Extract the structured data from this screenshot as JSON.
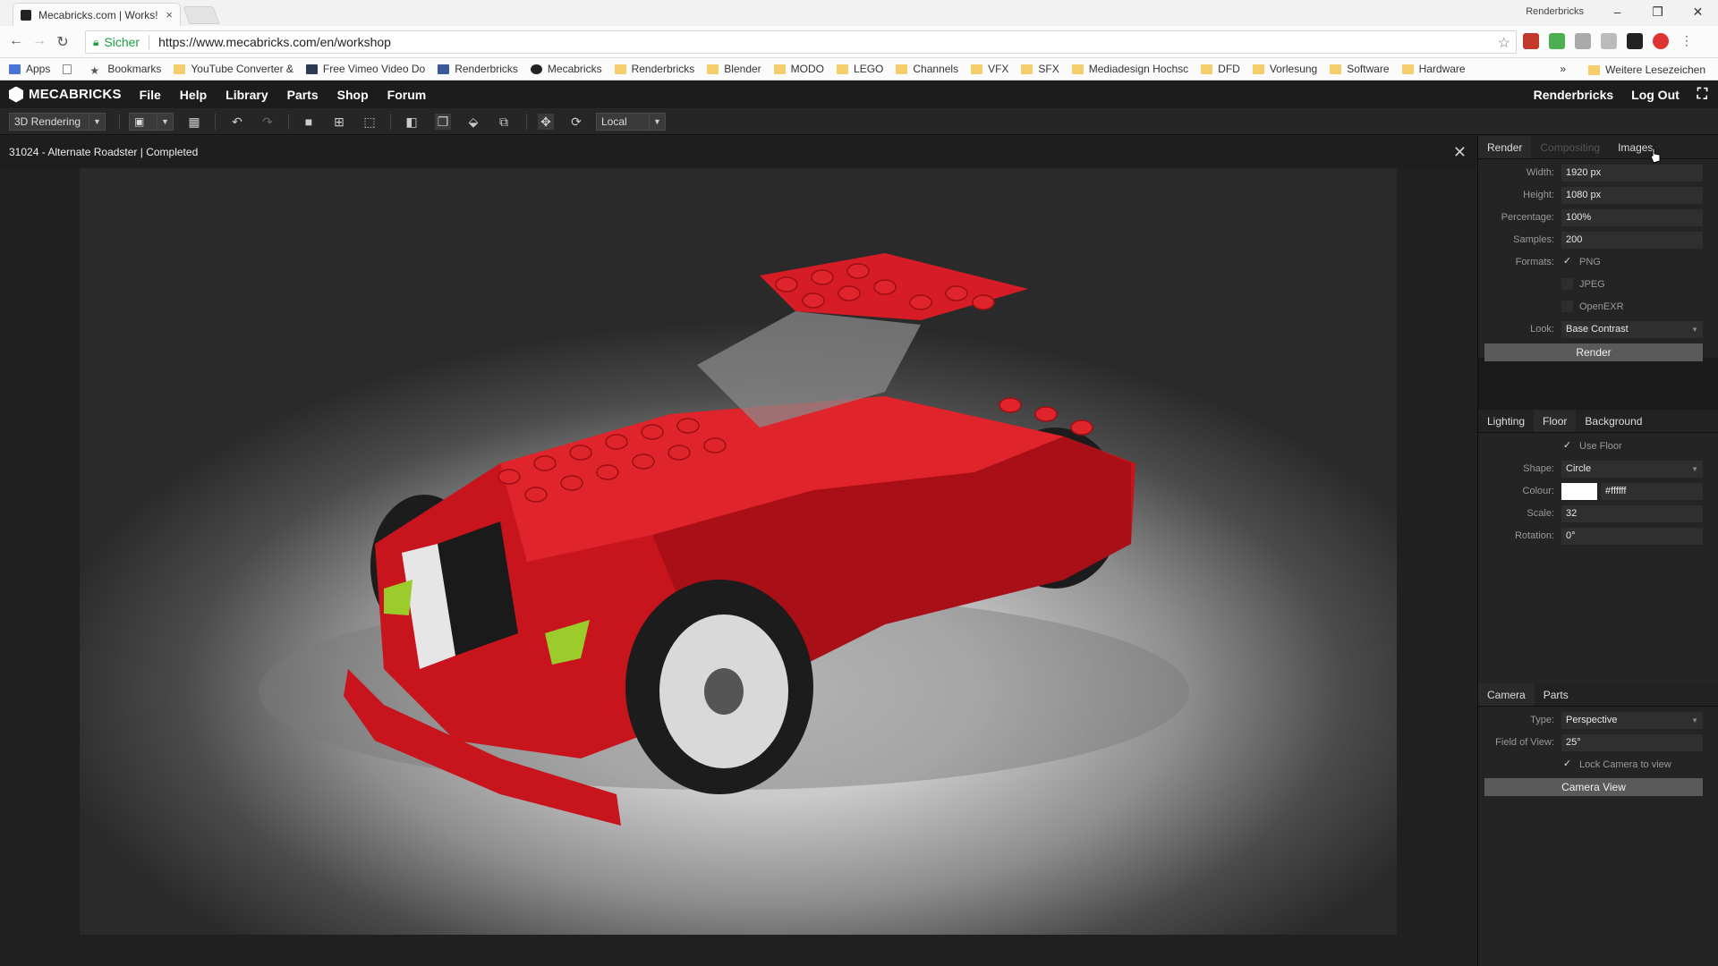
{
  "browser": {
    "tab_title": "Mecabricks.com | Works!",
    "tab_close": "×",
    "profile_name": "Renderbricks",
    "window_controls": [
      "–",
      "❐",
      "✕"
    ],
    "secure_label": "Sicher",
    "url": "https://www.mecabricks.com/en/workshop",
    "bookmarks": [
      {
        "label": "Apps",
        "icon": "apps-grid-icon"
      },
      {
        "label": "",
        "icon": "page-icon"
      },
      {
        "label": "Bookmarks",
        "icon": "star-icon"
      },
      {
        "label": "YouTube Converter &",
        "icon": "folder-icon"
      },
      {
        "label": "Free Vimeo Video Do",
        "icon": "vimeo-icon"
      },
      {
        "label": "Renderbricks",
        "icon": "facebook-icon"
      },
      {
        "label": "Mecabricks",
        "icon": "mecabricks-icon"
      },
      {
        "label": "Renderbricks",
        "icon": "folder-icon"
      },
      {
        "label": "Blender",
        "icon": "folder-icon"
      },
      {
        "label": "MODO",
        "icon": "folder-icon"
      },
      {
        "label": "LEGO",
        "icon": "folder-icon"
      },
      {
        "label": "Channels",
        "icon": "folder-icon"
      },
      {
        "label": "VFX",
        "icon": "folder-icon"
      },
      {
        "label": "SFX",
        "icon": "folder-icon"
      },
      {
        "label": "Mediadesign Hochsc",
        "icon": "folder-icon"
      },
      {
        "label": "DFD",
        "icon": "folder-icon"
      },
      {
        "label": "Vorlesung",
        "icon": "folder-icon"
      },
      {
        "label": "Software",
        "icon": "folder-icon"
      },
      {
        "label": "Hardware",
        "icon": "folder-icon"
      }
    ],
    "bookmarks_more": "»",
    "other_bookmarks": "Weitere Lesezeichen"
  },
  "app": {
    "logo": "MECABRICKS",
    "menu": [
      "File",
      "Help",
      "Library",
      "Parts",
      "Shop",
      "Forum"
    ],
    "user": "Renderbricks",
    "logout": "Log Out"
  },
  "toolbar": {
    "mode": "3D Rendering",
    "space": "Local"
  },
  "status": {
    "text": "31024 - Alternate Roadster | Completed"
  },
  "render_panel": {
    "tabs": [
      "Render",
      "Compositing",
      "Images"
    ],
    "width_label": "Width:",
    "width": "1920 px",
    "height_label": "Height:",
    "height": "1080 px",
    "percentage_label": "Percentage:",
    "percentage": "100%",
    "samples_label": "Samples:",
    "samples": "200",
    "formats_label": "Formats:",
    "formats": [
      {
        "label": "PNG",
        "checked": true
      },
      {
        "label": "JPEG",
        "checked": false
      },
      {
        "label": "OpenEXR",
        "checked": false
      }
    ],
    "look_label": "Look:",
    "look": "Base Contrast",
    "render_button": "Render"
  },
  "floor_panel": {
    "tabs": [
      "Lighting",
      "Floor",
      "Background"
    ],
    "use_floor": "Use Floor",
    "shape_label": "Shape:",
    "shape": "Circle",
    "colour_label": "Colour:",
    "colour_hex": "#ffffff",
    "scale_label": "Scale:",
    "scale": "32",
    "rotation_label": "Rotation:",
    "rotation": "0°"
  },
  "camera_panel": {
    "tabs": [
      "Camera",
      "Parts"
    ],
    "type_label": "Type:",
    "type": "Perspective",
    "fov_label": "Field of View:",
    "fov": "25°",
    "lock_camera": "Lock Camera to view",
    "camera_view_button": "Camera View"
  },
  "colors": {
    "brick_red": "#c8141c",
    "panel_bg": "#242424",
    "button_gray": "#5a5a5a"
  }
}
